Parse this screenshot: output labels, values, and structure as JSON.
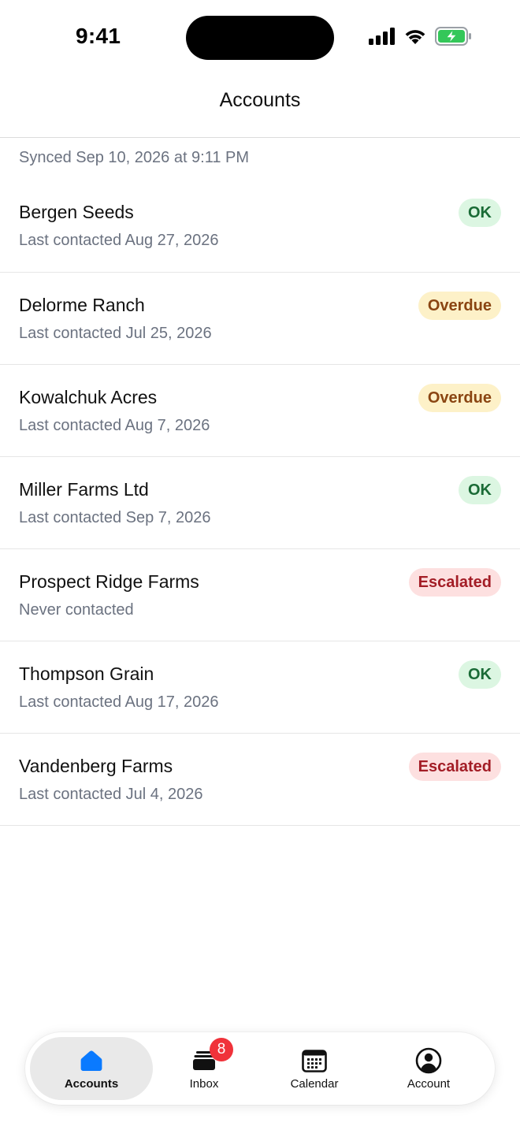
{
  "status_bar": {
    "time": "9:41"
  },
  "header": {
    "title": "Accounts"
  },
  "sync": {
    "text": "Synced Sep 10, 2026 at 9:11 PM"
  },
  "accounts": [
    {
      "name": "Bergen Seeds",
      "subtitle": "Last contacted Aug 27, 2026",
      "status": "OK",
      "status_kind": "ok"
    },
    {
      "name": "Delorme Ranch",
      "subtitle": "Last contacted Jul 25, 2026",
      "status": "Overdue",
      "status_kind": "overdue"
    },
    {
      "name": "Kowalchuk Acres",
      "subtitle": "Last contacted Aug 7, 2026",
      "status": "Overdue",
      "status_kind": "overdue"
    },
    {
      "name": "Miller Farms Ltd",
      "subtitle": "Last contacted Sep 7, 2026",
      "status": "OK",
      "status_kind": "ok"
    },
    {
      "name": "Prospect Ridge Farms",
      "subtitle": "Never contacted",
      "status": "Escalated",
      "status_kind": "escalated"
    },
    {
      "name": "Thompson Grain",
      "subtitle": "Last contacted Aug 17, 2026",
      "status": "OK",
      "status_kind": "ok"
    },
    {
      "name": "Vandenberg Farms",
      "subtitle": "Last contacted Jul 4, 2026",
      "status": "Escalated",
      "status_kind": "escalated"
    }
  ],
  "tabs": {
    "accounts": {
      "label": "Accounts",
      "icon": "home-icon",
      "active": true
    },
    "inbox": {
      "label": "Inbox",
      "icon": "inbox-icon",
      "badge": "8"
    },
    "calendar": {
      "label": "Calendar",
      "icon": "calendar-icon"
    },
    "account": {
      "label": "Account",
      "icon": "person-circle-icon"
    }
  },
  "colors": {
    "accent": "#0a7aff",
    "ok_bg": "#dcf6e2",
    "ok_text": "#1a6b36",
    "overdue_bg": "#fdf1c8",
    "overdue_text": "#8a4512",
    "escalated_bg": "#fde0e0",
    "escalated_text": "#a31d26",
    "badge_red": "#f0323a"
  }
}
